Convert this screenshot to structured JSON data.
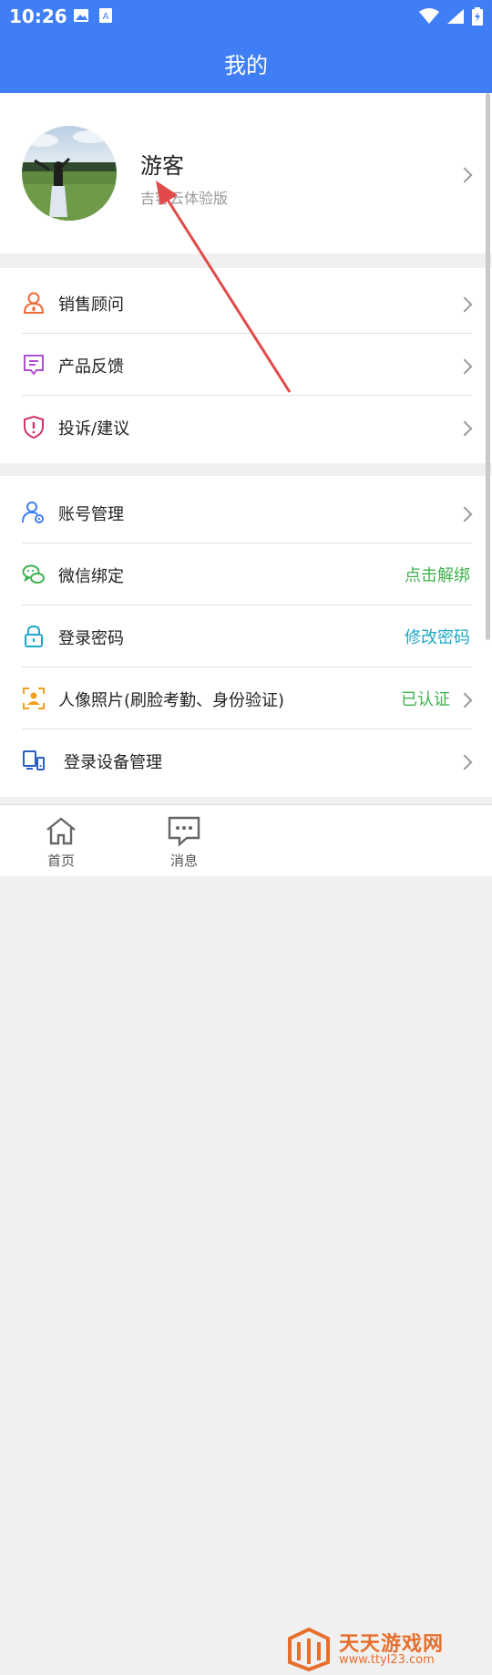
{
  "status_bar": {
    "time": "10:26"
  },
  "header": {
    "title": "我的"
  },
  "profile": {
    "name": "游客",
    "subtitle": "吉客云体验版"
  },
  "group1": [
    {
      "label": "销售顾问",
      "icon": "user-icon",
      "color": "#f06a3b"
    },
    {
      "label": "产品反馈",
      "icon": "feedback-icon",
      "color": "#b04fd0"
    },
    {
      "label": "投诉/建议",
      "icon": "shield-alert-icon",
      "color": "#d0326b"
    }
  ],
  "group2": [
    {
      "label": "账号管理",
      "icon": "user-settings-icon",
      "color": "#3f7ef5"
    },
    {
      "label": "微信绑定",
      "value": "点击解绑",
      "value_color": "#3eb24e",
      "icon": "wechat-icon",
      "color": "#3eb24e"
    },
    {
      "label": "登录密码",
      "value": "修改密码",
      "value_color": "#1ea8c8",
      "icon": "lock-icon",
      "color": "#1ea8c8"
    },
    {
      "label": "人像照片(刷脸考勤、身份验证)",
      "value": "已认证",
      "value_color": "#3eb24e",
      "icon": "face-scan-icon",
      "color": "#f0a020"
    },
    {
      "label": "登录设备管理",
      "icon": "device-icon",
      "color": "#2a5ec0"
    }
  ],
  "tabbar": {
    "home": "首页",
    "messages": "消息"
  },
  "watermark": {
    "name": "天天游戏网",
    "url": "www.ttyl23.com"
  }
}
